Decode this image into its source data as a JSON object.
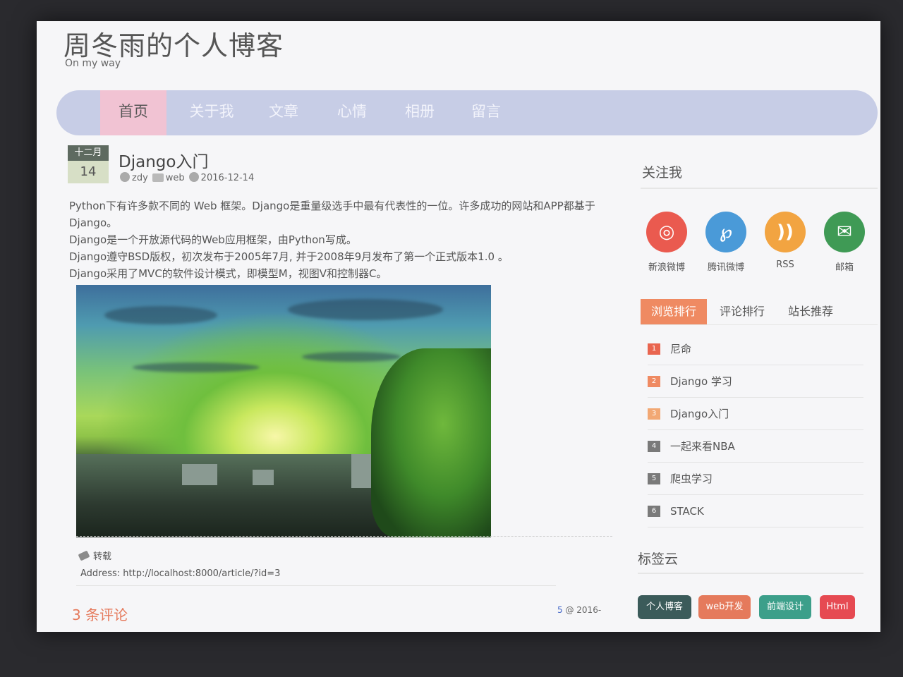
{
  "site": {
    "title": "周冬雨的个人博客",
    "subtitle": "On my way"
  },
  "nav": {
    "items": [
      {
        "label": "首页"
      },
      {
        "label": "关于我"
      },
      {
        "label": "文章"
      },
      {
        "label": "心情"
      },
      {
        "label": "相册"
      },
      {
        "label": "留言"
      }
    ]
  },
  "post": {
    "month": "十二月",
    "day": "14",
    "title": "Django入门",
    "author": "zdy",
    "category": "web",
    "date": "2016-12-14",
    "paragraphs": [
      "Python下有许多款不同的 Web 框架。Django是重量级选手中最有代表性的一位。许多成功的网站和APP都基于Django。",
      "Django是一个开放源代码的Web应用框架，由Python写成。",
      "Django遵守BSD版权，初次发布于2005年7月, 并于2008年9月发布了第一个正式版本1.0 。",
      "Django采用了MVC的软件设计模式，即模型M，视图V和控制器C。"
    ],
    "tag": "转载",
    "address": "Address: http://localhost:8000/article/?id=3",
    "comments_label": "3 条评论",
    "comment_count": "5",
    "comment_date": "@ 2016-"
  },
  "sidebar": {
    "follow_heading": "关注我",
    "social": [
      {
        "label": "新浪微博",
        "color": "#ea5a4f",
        "icon": "weibo-icon",
        "glyph": "◎"
      },
      {
        "label": "腾讯微博",
        "color": "#4a9ad8",
        "icon": "tencent-weibo-icon",
        "glyph": "℘"
      },
      {
        "label": "RSS",
        "color": "#f2a441",
        "icon": "rss-icon",
        "glyph": "))"
      },
      {
        "label": "邮箱",
        "color": "#3f9a55",
        "icon": "mail-icon",
        "glyph": "✉"
      }
    ],
    "tabs": [
      {
        "label": "浏览排行"
      },
      {
        "label": "评论排行"
      },
      {
        "label": "站长推荐"
      }
    ],
    "ranking": [
      {
        "num": "1",
        "title": "尼命",
        "color": "#e9654f"
      },
      {
        "num": "2",
        "title": "Django 学习",
        "color": "#ef8a62"
      },
      {
        "num": "3",
        "title": "Django入门",
        "color": "#f2a874"
      },
      {
        "num": "4",
        "title": "一起来看NBA",
        "color": "#7a7a7a"
      },
      {
        "num": "5",
        "title": "爬虫学习",
        "color": "#7a7a7a"
      },
      {
        "num": "6",
        "title": "STACK",
        "color": "#7a7a7a"
      }
    ],
    "tag_cloud_heading": "标签云",
    "tag_cloud": [
      {
        "label": "个人博客",
        "color": "#3b5b5a"
      },
      {
        "label": "web开发",
        "color": "#e57a5c"
      },
      {
        "label": "前端设计",
        "color": "#3c9f8a"
      },
      {
        "label": "Html",
        "color": "#e64a52"
      }
    ]
  }
}
